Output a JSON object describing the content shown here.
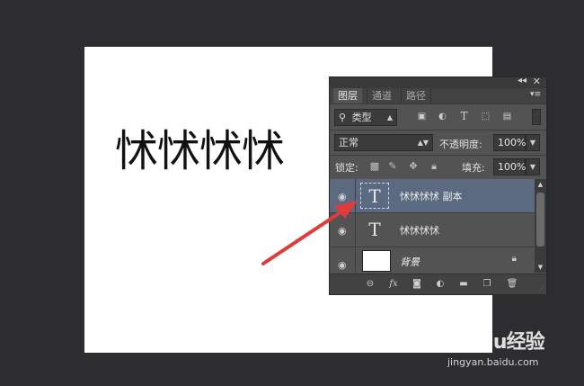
{
  "canvas": {
    "text": "怵怵怵怵"
  },
  "panel": {
    "tabs": [
      {
        "label": "图层"
      },
      {
        "label": "通道"
      },
      {
        "label": "路径"
      }
    ],
    "filter": {
      "search_glyph": "⚲",
      "kind_label": "类型"
    },
    "blend": {
      "mode": "正常"
    },
    "opacity": {
      "label": "不透明度:",
      "value": "100%"
    },
    "lock": {
      "label": "锁定:"
    },
    "fill": {
      "label": "填充:",
      "value": "100%"
    },
    "layers": [
      {
        "name": "怵怵怵怵 副本",
        "type": "text",
        "thumb": "T",
        "selected": true
      },
      {
        "name": "怵怵怵怵",
        "type": "text",
        "thumb": "T",
        "selected": false
      },
      {
        "name": "背景",
        "type": "background",
        "selected": false
      }
    ],
    "colors": {
      "selection": "#5b6a80",
      "annotation_arrow": "#e03a3a"
    }
  },
  "watermark": {
    "main": "Baidu经验",
    "sub": "jingyan.baidu.com"
  }
}
